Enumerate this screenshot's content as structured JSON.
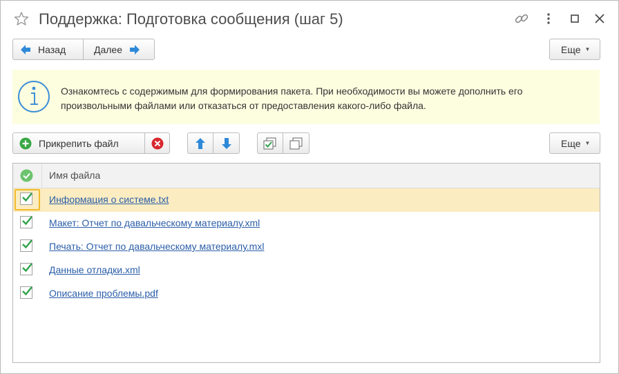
{
  "window": {
    "title": "Поддержка: Подготовка сообщения (шаг 5)",
    "icons": [
      "star-icon",
      "link-icon",
      "more-vert-icon",
      "maximize-icon",
      "close-icon"
    ]
  },
  "nav": {
    "back_label": "Назад",
    "next_label": "Далее",
    "more_label": "Еще"
  },
  "info": {
    "text": "Ознакомтесь с содержимым для формирования пакета. При необходимости вы можете дополнить его произвольными файлами или отказаться от предоставления какого-либо файла."
  },
  "toolbar": {
    "attach_label": "Прикрепить файл",
    "more_label": "Еще"
  },
  "table": {
    "column_header": "Имя файла",
    "rows": [
      {
        "name": "Информация о системе.txt",
        "checked": true
      },
      {
        "name": "Макет: Отчет по давальческому материалу.xml",
        "checked": true
      },
      {
        "name": "Печать: Отчет по давальческому материалу.mxl",
        "checked": true
      },
      {
        "name": "Данные отладки.xml",
        "checked": true
      },
      {
        "name": "Описание проблемы.pdf",
        "checked": true
      }
    ]
  },
  "colors": {
    "accent_blue": "#2e89d8",
    "link": "#2b5ea8",
    "check_green": "#2fa24a",
    "remove_red": "#d9272e",
    "info_bg": "#fdfde0",
    "selected_row": "#fbecc1"
  }
}
